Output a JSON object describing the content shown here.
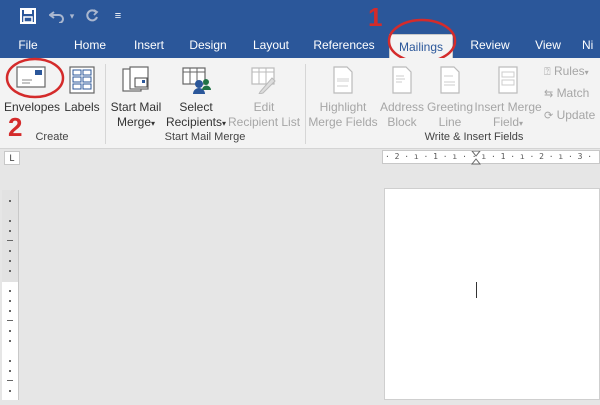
{
  "tabs": [
    {
      "label": "File"
    },
    {
      "label": "Home"
    },
    {
      "label": "Insert"
    },
    {
      "label": "Design"
    },
    {
      "label": "Layout"
    },
    {
      "label": "References"
    },
    {
      "label": "Mailings"
    },
    {
      "label": "Review"
    },
    {
      "label": "View"
    },
    {
      "label": "Ni"
    }
  ],
  "ribbon": {
    "create": {
      "group_label": "Create",
      "envelopes": "Envelopes",
      "labels": "Labels"
    },
    "start_mail_merge": {
      "group_label": "Start Mail Merge",
      "start_mail_merge_l1": "Start Mail",
      "start_mail_merge_l2": "Merge",
      "select_recipients_l1": "Select",
      "select_recipients_l2": "Recipients",
      "edit_recipient_list_l1": "Edit",
      "edit_recipient_list_l2": "Recipient List"
    },
    "write_insert": {
      "group_label": "Write & Insert Fields",
      "highlight_l1": "Highlight",
      "highlight_l2": "Merge Fields",
      "address_l1": "Address",
      "address_l2": "Block",
      "greeting_l1": "Greeting",
      "greeting_l2": "Line",
      "insert_merge_l1": "Insert Merge",
      "insert_merge_l2": "Field",
      "rules": "Rules",
      "match": "Match",
      "update": "Update"
    }
  },
  "annotations": {
    "one": "1",
    "two": "2"
  },
  "ruler": {
    "h_ticks": "· 2 · ı · 1 · ı ·  ·  ı · 1 · ı · 2 · ı · 3 ·"
  },
  "ruler_corner": "L",
  "colors": {
    "title_bar": "#2b579a",
    "annotation_red": "#d42b2b"
  }
}
